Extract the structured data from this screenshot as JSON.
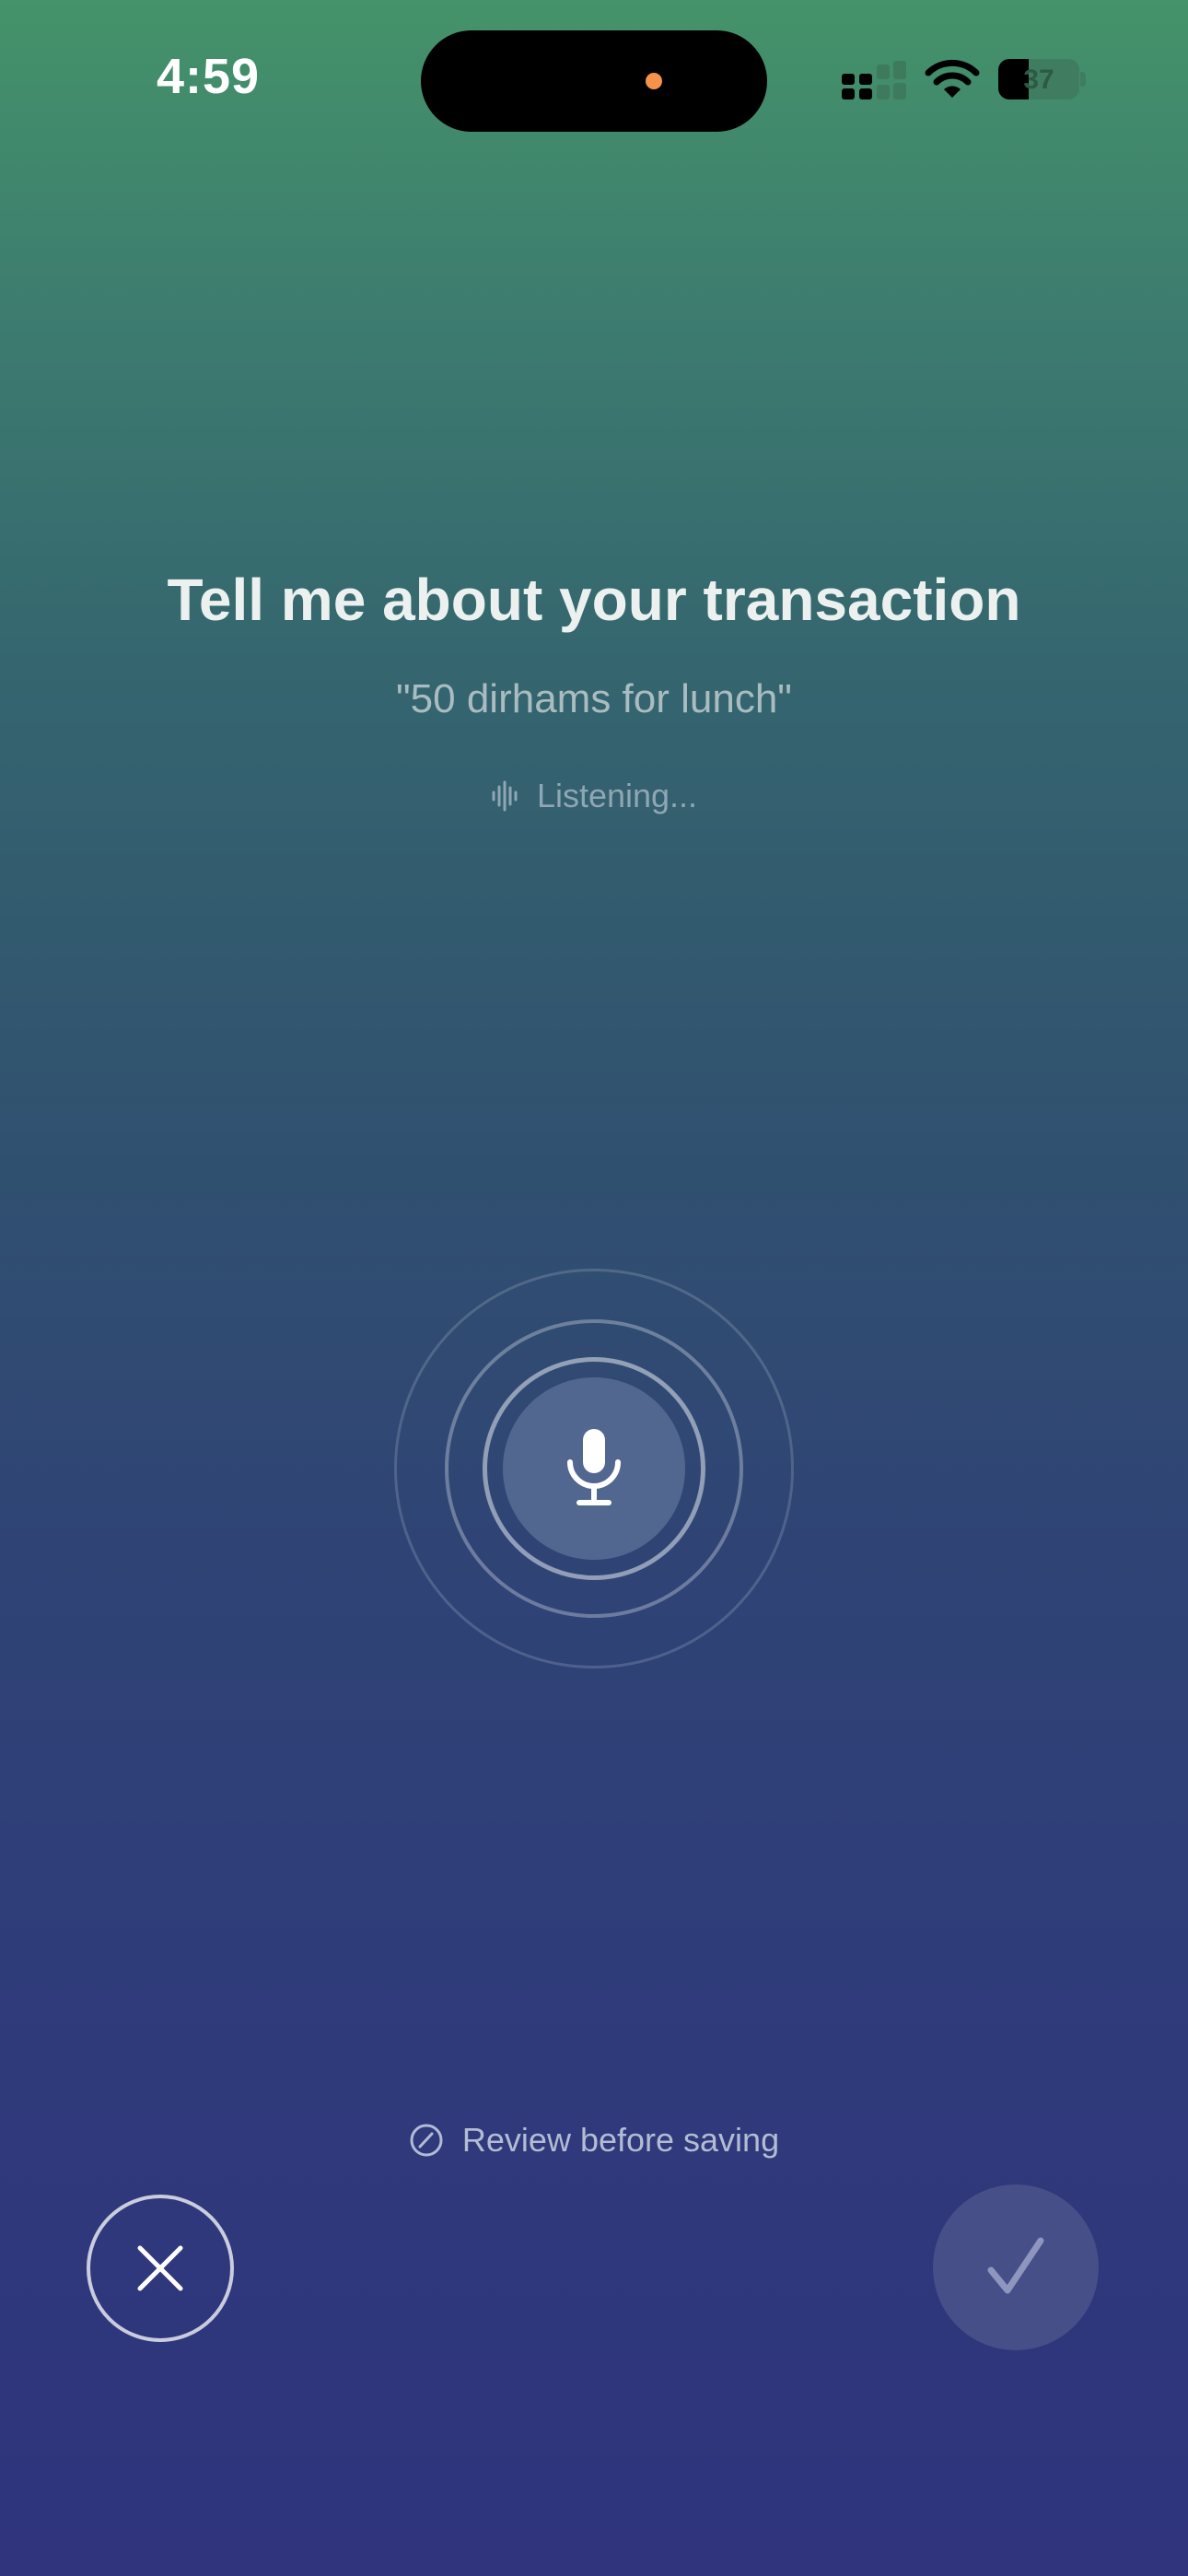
{
  "status_bar": {
    "time": "4:59",
    "battery_level": "37",
    "signal_icon": "cellular-signal-icon",
    "wifi_icon": "wifi-icon"
  },
  "prompt": {
    "title": "Tell me about your transaction",
    "example": "\"50 dirhams for lunch\"",
    "listening_label": "Listening...",
    "listening_icon": "waveform-icon"
  },
  "mic": {
    "icon": "microphone-icon"
  },
  "footer": {
    "review_label": "Review before saving",
    "review_icon": "edit-circle-icon",
    "cancel_icon": "close-icon",
    "confirm_icon": "checkmark-icon"
  },
  "colors": {
    "gradient_top": "#44936a",
    "gradient_bottom": "#2f347c",
    "recording_dot": "#f7924a",
    "mic_button": "#52678f",
    "confirm_button": "#464f88"
  }
}
